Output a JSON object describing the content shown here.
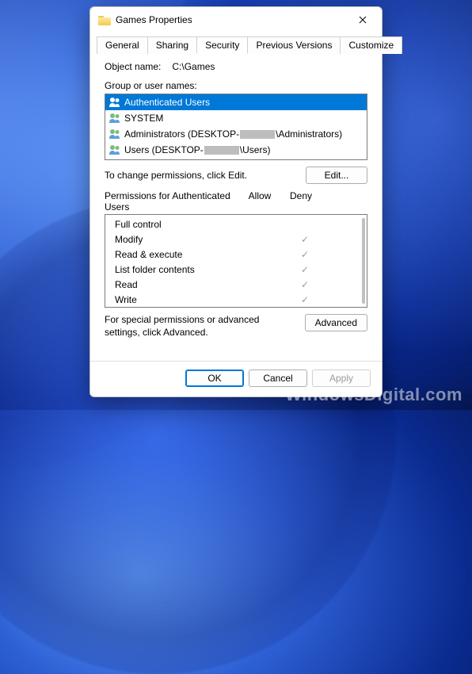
{
  "title": "Games Properties",
  "tabs": [
    "General",
    "Sharing",
    "Security",
    "Previous Versions",
    "Customize"
  ],
  "active_tab_index": 2,
  "object_name_label": "Object name:",
  "object_name_value": "C:\\Games",
  "group_label": "Group or user names:",
  "principals": [
    {
      "name": "Authenticated Users",
      "selected": true,
      "redacted": false
    },
    {
      "name": "SYSTEM",
      "selected": false,
      "redacted": false
    },
    {
      "prefix": "Administrators (DESKTOP-",
      "suffix": "\\Administrators)",
      "selected": false,
      "redacted": true
    },
    {
      "prefix": "Users (DESKTOP-",
      "suffix": "\\Users)",
      "selected": false,
      "redacted": true
    }
  ],
  "edit_hint": "To change permissions, click Edit.",
  "edit_button": "Edit...",
  "perm_for_label": "Permissions for Authenticated Users",
  "allow_label": "Allow",
  "deny_label": "Deny",
  "permissions": [
    {
      "name": "Full control",
      "allow": false,
      "deny": false
    },
    {
      "name": "Modify",
      "allow": true,
      "deny": false
    },
    {
      "name": "Read & execute",
      "allow": true,
      "deny": false
    },
    {
      "name": "List folder contents",
      "allow": true,
      "deny": false
    },
    {
      "name": "Read",
      "allow": true,
      "deny": false
    },
    {
      "name": "Write",
      "allow": true,
      "deny": false
    }
  ],
  "advanced_hint": "For special permissions or advanced settings, click Advanced.",
  "advanced_button": "Advanced",
  "footer": {
    "ok": "OK",
    "cancel": "Cancel",
    "apply": "Apply"
  },
  "watermark": "WindowsDigital.com"
}
